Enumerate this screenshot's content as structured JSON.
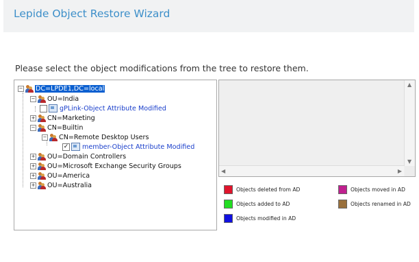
{
  "header": {
    "title": "Lepide Object Restore Wizard"
  },
  "instruction": "Please select the object modifications from the tree to restore them.",
  "tree": {
    "root": "DC=LPDE1,DC=local",
    "n1": "OU=India",
    "n1_child": "gPLink-Object Attribute Modified",
    "n2": "CN=Marketing",
    "n3": "CN=Builtin",
    "n3_child": "CN=Remote Desktop Users",
    "n3_grandchild": "member-Object Attribute Modified",
    "n4": "OU=Domain Controllers",
    "n5": "OU=Microsoft Exchange Security Groups",
    "n6": "OU=America",
    "n7": "OU=Australia"
  },
  "legend": {
    "deleted": {
      "label": "Objects deleted from AD",
      "color": "#e0142c"
    },
    "added": {
      "label": "Objects added to AD",
      "color": "#22dd22"
    },
    "modified": {
      "label": "Objects modified in AD",
      "color": "#1010e0"
    },
    "moved": {
      "label": "Objects moved in AD",
      "color": "#c0208f"
    },
    "renamed": {
      "label": "Objects renamed in AD",
      "color": "#99703c"
    }
  },
  "icons": {
    "expanded": "minus",
    "collapsed": "plus",
    "check": "✓"
  }
}
